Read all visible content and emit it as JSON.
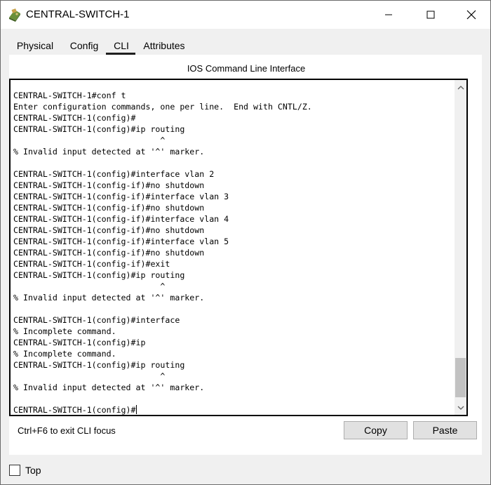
{
  "window": {
    "title": "CENTRAL-SWITCH-1",
    "icon": "cisco-device-icon"
  },
  "tabs": [
    {
      "label": "Physical",
      "active": false
    },
    {
      "label": "Config",
      "active": false
    },
    {
      "label": "CLI",
      "active": true
    },
    {
      "label": "Attributes",
      "active": false
    }
  ],
  "cli": {
    "heading": "IOS Command Line Interface",
    "lines": [
      "CENTRAL-SWITCH-1#conf t",
      "Enter configuration commands, one per line.  End with CNTL/Z.",
      "CENTRAL-SWITCH-1(config)#",
      "CENTRAL-SWITCH-1(config)#ip routing",
      "                              ^",
      "% Invalid input detected at '^' marker.",
      "",
      "CENTRAL-SWITCH-1(config)#interface vlan 2",
      "CENTRAL-SWITCH-1(config-if)#no shutdown",
      "CENTRAL-SWITCH-1(config-if)#interface vlan 3",
      "CENTRAL-SWITCH-1(config-if)#no shutdown",
      "CENTRAL-SWITCH-1(config-if)#interface vlan 4",
      "CENTRAL-SWITCH-1(config-if)#no shutdown",
      "CENTRAL-SWITCH-1(config-if)#interface vlan 5",
      "CENTRAL-SWITCH-1(config-if)#no shutdown",
      "CENTRAL-SWITCH-1(config-if)#exit",
      "CENTRAL-SWITCH-1(config)#ip routing",
      "                              ^",
      "% Invalid input detected at '^' marker.",
      "",
      "CENTRAL-SWITCH-1(config)#interface",
      "% Incomplete command.",
      "CENTRAL-SWITCH-1(config)#ip",
      "% Incomplete command.",
      "CENTRAL-SWITCH-1(config)#ip routing",
      "                              ^",
      "% Invalid input detected at '^' marker.",
      "",
      "CENTRAL-SWITCH-1(config)#"
    ]
  },
  "footer": {
    "hint": "Ctrl+F6 to exit CLI focus",
    "copy_label": "Copy",
    "paste_label": "Paste"
  },
  "bottom": {
    "top_label": "Top",
    "top_checked": false
  }
}
